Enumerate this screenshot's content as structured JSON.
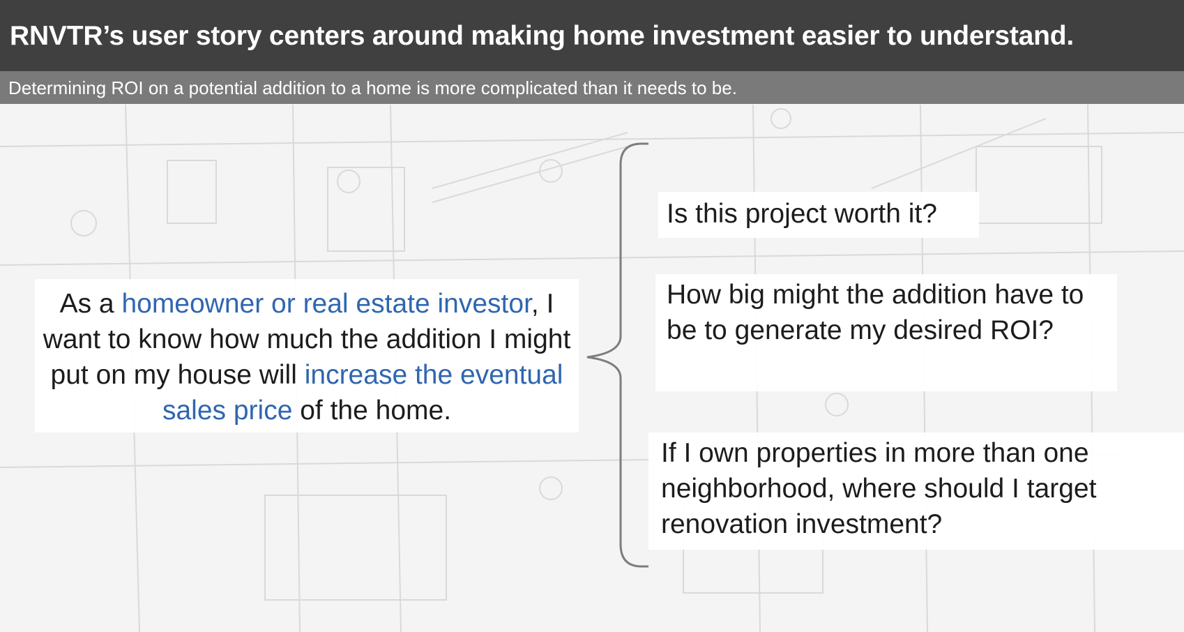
{
  "header": {
    "title": "RNVTR’s user story centers around making home investment easier to understand.",
    "subtitle": "Determining ROI on a potential addition to a home is more complicated than it needs to be."
  },
  "user_story": {
    "part1": "As a ",
    "highlight1": "homeowner or real estate investor",
    "part2": ", I want to know how much the addition I might put on my house will ",
    "highlight2": "increase the eventual sales price",
    "part3": " of the home."
  },
  "questions": [
    "Is this project worth it?",
    "How big might the addition have to be to generate my desired ROI?",
    "If I own properties in more than one neighborhood, where should I target renovation investment?"
  ],
  "colors": {
    "title_bar": "#404040",
    "subtitle_bar": "#7a7a7a",
    "highlight": "#2f66b0"
  }
}
